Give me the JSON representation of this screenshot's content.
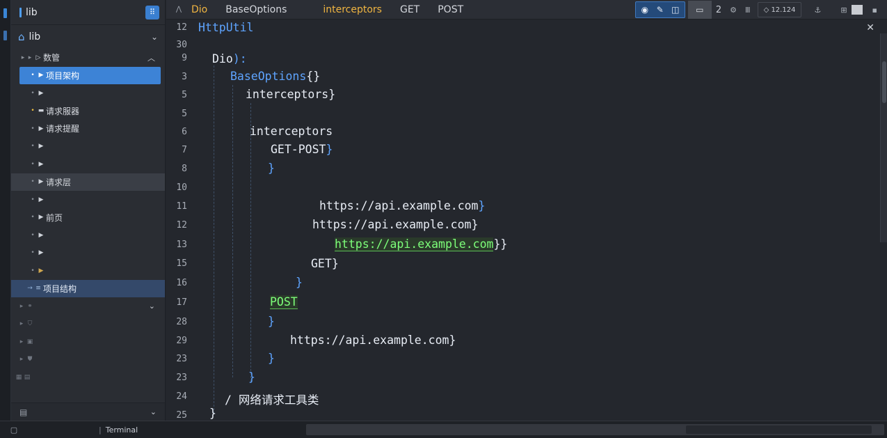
{
  "sidebar": {
    "title": "lib",
    "project": "lib",
    "group_label": "数管",
    "items": [
      {
        "label": "项目架构",
        "state": "selected"
      },
      {
        "label": "",
        "state": "normal"
      },
      {
        "label": "请求服器",
        "state": "normal"
      },
      {
        "label": "请求提醒",
        "state": "normal"
      },
      {
        "label": "",
        "state": "normal"
      },
      {
        "label": "",
        "state": "normal"
      },
      {
        "label": "请求层",
        "state": "hover"
      },
      {
        "label": "",
        "state": "normal"
      },
      {
        "label": "前页",
        "state": "normal"
      },
      {
        "label": "",
        "state": "normal"
      },
      {
        "label": "",
        "state": "normal"
      },
      {
        "label": "",
        "state": "gold"
      }
    ],
    "active_item": "项目结构",
    "dim_items": [
      "",
      "",
      "",
      "",
      ""
    ],
    "bottom_label": ""
  },
  "toolbar": {
    "crumbs": [
      "Dio",
      "BaseOptions",
      "",
      "interceptors",
      "GET",
      "POST"
    ],
    "count": "2",
    "position": "12.124"
  },
  "editor": {
    "line_numbers": [
      "12",
      "30",
      "9",
      "3",
      "5",
      "5",
      "6",
      "7",
      "8",
      "10",
      "11",
      "12",
      "13",
      "15",
      "16",
      "17",
      "28",
      "29",
      "23",
      "23",
      "24",
      "25"
    ],
    "lines": {
      "l0_name": "HttpUtil",
      "l2_a": "Dio",
      "l2_b": "):",
      "l3_a": "BaseOptions",
      "l3_b": "{",
      "l3_c": "}",
      "l4_a": "interceptors",
      "l4_b": "}",
      "l6_a": "interceptors",
      "l7_a": "GET-POST",
      "l7_b": "}",
      "l8_a": "}",
      "l10_a": "https://",
      "l10_b": "api.example.com",
      "l10_c": "}",
      "l11_a": "https://api.example.com",
      "l11_b": "}",
      "l12_a": "https://api.example.com",
      "l12_b": "}",
      "l12_c": "}",
      "l13_a": "GET",
      "l13_b": "}",
      "l14_a": "}",
      "l15_a": "POST",
      "l16_a": "}",
      "l17_a": "https://api.example.com",
      "l17_b": "}",
      "l18_a": "}",
      "l19_a": "}",
      "l20_a": "/ 网络请求工具类",
      "l21_a": "}"
    }
  },
  "statusbar": {
    "item1": "",
    "item2": "",
    "item3": "",
    "item4": "Terminal"
  },
  "colors": {
    "accent": "#3d83d6",
    "keyword_gold": "#f0b541",
    "code_blue": "#5ea4ff",
    "string_green": "#7dff7a",
    "editor_bg": "#24272d"
  },
  "icons": [
    "home-icon",
    "chevron-down-icon",
    "chevron-up-icon",
    "close-icon",
    "grid-icon",
    "terminal-icon"
  ]
}
